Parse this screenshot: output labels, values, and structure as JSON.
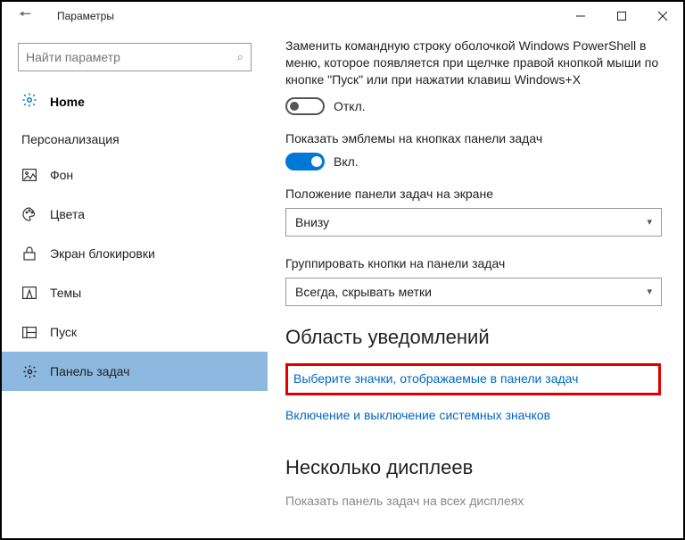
{
  "window": {
    "title": "Параметры"
  },
  "search": {
    "placeholder": "Найти параметр"
  },
  "home": {
    "label": "Home"
  },
  "category": {
    "label": "Персонализация"
  },
  "nav": [
    {
      "label": "Фон"
    },
    {
      "label": "Цвета"
    },
    {
      "label": "Экран блокировки"
    },
    {
      "label": "Темы"
    },
    {
      "label": "Пуск"
    },
    {
      "label": "Панель задач"
    }
  ],
  "main": {
    "powershell_desc": "Заменить командную строку оболочкой Windows PowerShell в меню, которое появляется при щелчке правой кнопкой мыши по кнопке \"Пуск\" или при нажатии клавиш Windows+X",
    "off_label": "Откл.",
    "badges_label": "Показать эмблемы на кнопках панели задач",
    "on_label": "Вкл.",
    "position_label": "Положение панели задач на экране",
    "position_value": "Внизу",
    "group_label": "Группировать кнопки на панели задач",
    "group_value": "Всегда, скрывать метки",
    "section_notifications": "Область уведомлений",
    "link_icons": "Выберите значки, отображаемые в панели задач",
    "link_system_icons": "Включение и выключение системных значков",
    "section_multi": "Несколько дисплеев",
    "multi_desc": "Показать панель задач на всех дисплеях"
  }
}
